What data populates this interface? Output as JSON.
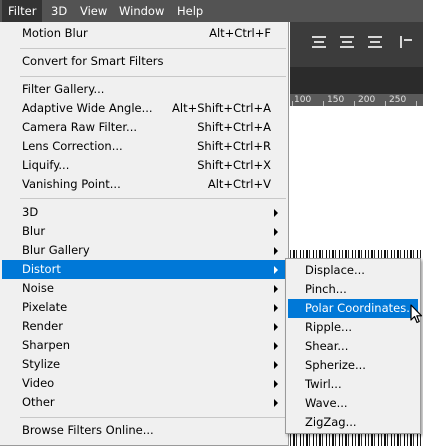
{
  "menubar": {
    "items": [
      {
        "label": "Filter",
        "active": true
      },
      {
        "label": "3D"
      },
      {
        "label": "View"
      },
      {
        "label": "Window"
      },
      {
        "label": "Help"
      }
    ]
  },
  "ruler": {
    "ticks": [
      "100",
      "150",
      "200",
      "250"
    ]
  },
  "filter_menu": {
    "items": [
      {
        "label": "Motion Blur",
        "shortcut": "Alt+Ctrl+F"
      },
      {
        "label": "Convert for Smart Filters",
        "shortcut": ""
      },
      {
        "label": "Filter Gallery...",
        "shortcut": ""
      },
      {
        "label": "Adaptive Wide Angle...",
        "shortcut": "Alt+Shift+Ctrl+A"
      },
      {
        "label": "Camera Raw Filter...",
        "shortcut": "Shift+Ctrl+A"
      },
      {
        "label": "Lens Correction...",
        "shortcut": "Shift+Ctrl+R"
      },
      {
        "label": "Liquify...",
        "shortcut": "Shift+Ctrl+X"
      },
      {
        "label": "Vanishing Point...",
        "shortcut": "Alt+Ctrl+V"
      },
      {
        "label": "3D",
        "submenu": true
      },
      {
        "label": "Blur",
        "submenu": true
      },
      {
        "label": "Blur Gallery",
        "submenu": true
      },
      {
        "label": "Distort",
        "submenu": true,
        "highlighted": true
      },
      {
        "label": "Noise",
        "submenu": true
      },
      {
        "label": "Pixelate",
        "submenu": true
      },
      {
        "label": "Render",
        "submenu": true
      },
      {
        "label": "Sharpen",
        "submenu": true
      },
      {
        "label": "Stylize",
        "submenu": true
      },
      {
        "label": "Video",
        "submenu": true
      },
      {
        "label": "Other",
        "submenu": true
      },
      {
        "label": "Browse Filters Online...",
        "shortcut": ""
      }
    ]
  },
  "distort_submenu": {
    "items": [
      {
        "label": "Displace..."
      },
      {
        "label": "Pinch..."
      },
      {
        "label": "Polar Coordinates...",
        "highlighted": true
      },
      {
        "label": "Ripple..."
      },
      {
        "label": "Shear..."
      },
      {
        "label": "Spherize..."
      },
      {
        "label": "Twirl..."
      },
      {
        "label": "Wave..."
      },
      {
        "label": "ZigZag..."
      }
    ]
  },
  "colors": {
    "highlight": "#0078d7",
    "menubar": "#535353",
    "menu_bg": "#f0f0f0"
  }
}
